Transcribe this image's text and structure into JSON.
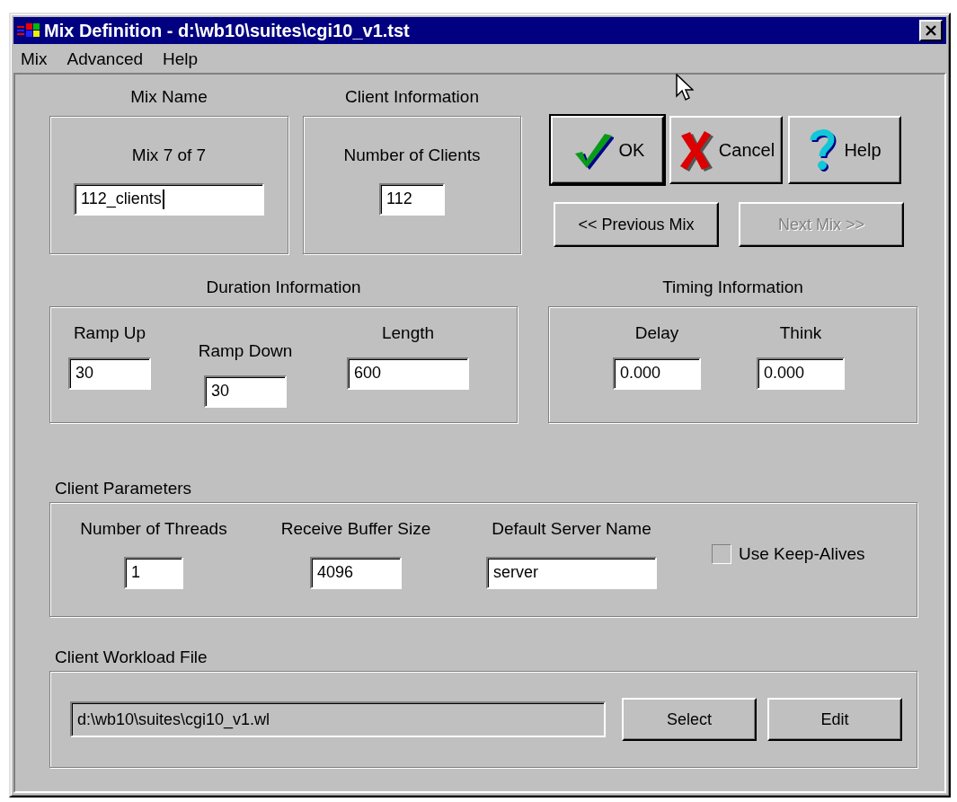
{
  "window": {
    "title": "Mix Definition - d:\\wb10\\suites\\cgi10_v1.tst"
  },
  "menu": [
    {
      "label": "Mix"
    },
    {
      "label": "Advanced"
    },
    {
      "label": "Help"
    }
  ],
  "mix_name": {
    "heading": "Mix Name",
    "counter": "Mix 7 of 7",
    "value": "112_clients",
    "focused": true
  },
  "client_information": {
    "heading": "Client Information",
    "label": "Number of Clients",
    "value": "112"
  },
  "buttons": [
    {
      "label": "OK",
      "kind": "ok",
      "default": true
    },
    {
      "label": "Cancel",
      "kind": "cancel",
      "default": false
    },
    {
      "label": "Help",
      "kind": "help",
      "default": false
    }
  ],
  "navigation": [
    {
      "label": "<< Previous Mix",
      "disabled": false
    },
    {
      "label": "Next Mix >>",
      "disabled": true
    }
  ],
  "duration": {
    "heading": "Duration Information",
    "fields": [
      {
        "label": "Ramp Up",
        "value": "30"
      },
      {
        "label": "Ramp Down",
        "value": "30"
      },
      {
        "label": "Length",
        "value": "600"
      }
    ]
  },
  "timing": {
    "heading": "Timing Information",
    "fields": [
      {
        "label": "Delay",
        "value": "0.000"
      },
      {
        "label": "Think",
        "value": "0.000"
      }
    ]
  },
  "client_parameters": {
    "heading": "Client Parameters",
    "fields": [
      {
        "label": "Number of Threads",
        "value": "1"
      },
      {
        "label": "Receive Buffer Size",
        "value": "4096"
      },
      {
        "label": "Default Server Name",
        "value": "server"
      }
    ],
    "keep_alives": {
      "label": "Use Keep-Alives",
      "checked": false
    }
  },
  "workload": {
    "heading": "Client Workload File",
    "path": "d:\\wb10\\suites\\cgi10_v1.wl",
    "buttons": [
      {
        "label": "Select"
      },
      {
        "label": "Edit"
      }
    ]
  }
}
